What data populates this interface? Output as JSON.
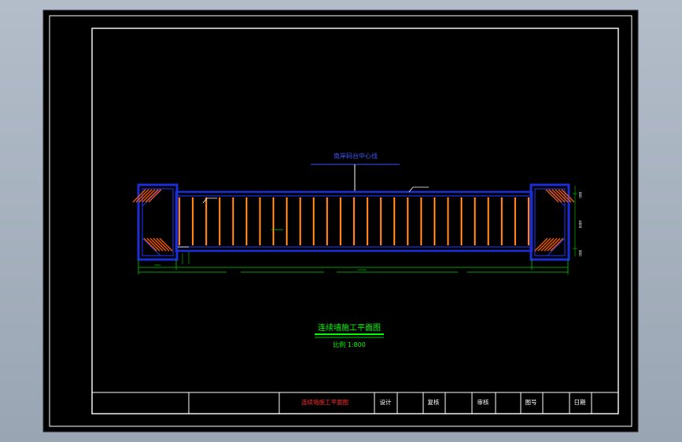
{
  "drawing": {
    "axis_label": "南岸码台中心线",
    "dim_left": "3000",
    "dim_total": "125000",
    "drawing_title": "连续墙施工平面图",
    "scale_text": "比例 1:800",
    "side_dims": [
      "800",
      "4800",
      "800"
    ]
  },
  "title_block": {
    "name": "连续墙施工平面图",
    "design_label": "设计",
    "check_label": "复核",
    "review_label": "审核",
    "drawing_no_label": "图号",
    "date_label": "日期"
  },
  "colors": {
    "background": "#000000",
    "frame": "#ffffff",
    "wall": "#1c2fd6",
    "rebar": "#ff5a00",
    "rebar_core": "#ffd23a",
    "dimension": "#00d000",
    "title_green": "#00ff00",
    "title_red": "#ff2a2a",
    "axis_blue": "#3f55ff"
  }
}
